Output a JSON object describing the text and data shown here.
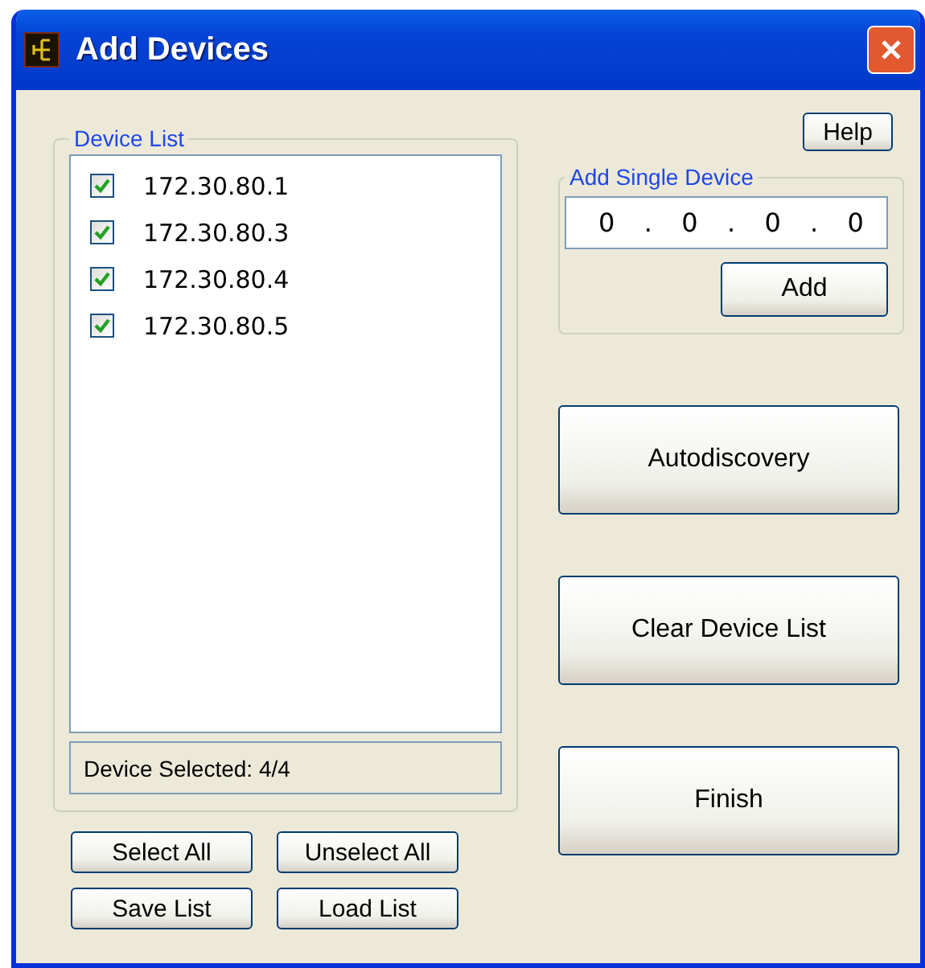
{
  "window": {
    "title": "Add Devices"
  },
  "help_button": "Help",
  "device_list": {
    "title": "Device List",
    "items": [
      {
        "address": "172.30.80.1",
        "checked": true
      },
      {
        "address": "172.30.80.3",
        "checked": true
      },
      {
        "address": "172.30.80.4",
        "checked": true
      },
      {
        "address": "172.30.80.5",
        "checked": true
      }
    ],
    "status": "Device Selected: 4/4"
  },
  "list_buttons": [
    "Select All",
    "Unselect All",
    "Save List",
    "Load List"
  ],
  "add_single": {
    "title": "Add Single Device",
    "ip_parts": [
      "0",
      ".",
      "0",
      ".",
      "0",
      ".",
      "0"
    ],
    "button": "Add"
  },
  "action_buttons": [
    "Autodiscovery",
    "Clear Device List",
    "Finish"
  ]
}
